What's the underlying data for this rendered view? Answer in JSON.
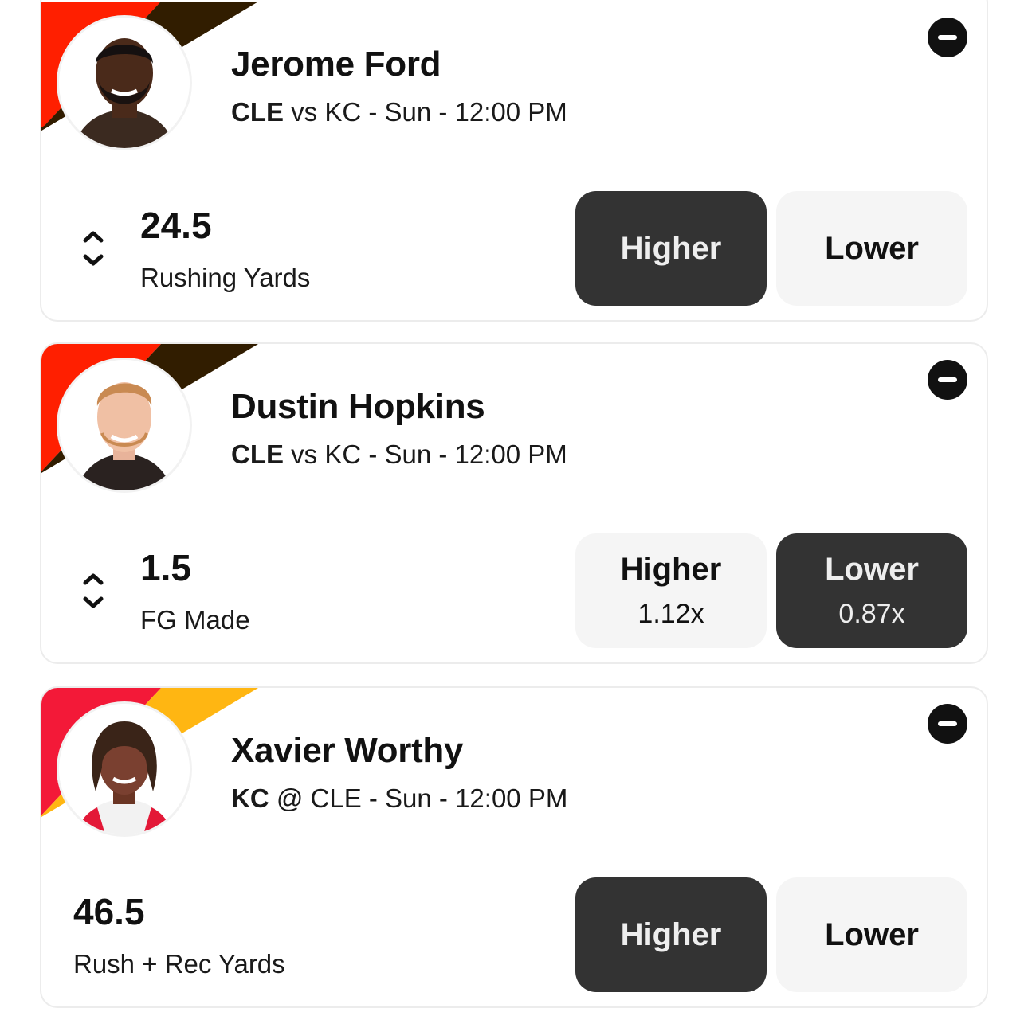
{
  "cards": [
    {
      "player": "Jerome Ford",
      "team": "CLE",
      "matchup": " vs KC - Sun - 12:00 PM",
      "line": "24.5",
      "stat": "Rushing Yards",
      "higher": {
        "label": "Higher",
        "multiplier": ""
      },
      "lower": {
        "label": "Lower",
        "multiplier": ""
      },
      "selected": "higher",
      "team_colors": {
        "primary": "#ff1f00",
        "secondary": "#311d00"
      },
      "icons": {
        "remove": "minus-circle-icon",
        "adjust": "chevron-up-down-icon"
      }
    },
    {
      "player": "Dustin Hopkins",
      "team": "CLE",
      "matchup": " vs KC - Sun - 12:00 PM",
      "line": "1.5",
      "stat": "FG Made",
      "higher": {
        "label": "Higher",
        "multiplier": "1.12x"
      },
      "lower": {
        "label": "Lower",
        "multiplier": "0.87x"
      },
      "selected": "lower",
      "team_colors": {
        "primary": "#ff1f00",
        "secondary": "#311d00"
      },
      "icons": {
        "remove": "minus-circle-icon",
        "adjust": "chevron-up-down-icon"
      }
    },
    {
      "player": "Xavier Worthy",
      "team": "KC",
      "matchup": " @ CLE - Sun - 12:00 PM",
      "line": "46.5",
      "stat": "Rush + Rec Yards",
      "higher": {
        "label": "Higher",
        "multiplier": ""
      },
      "lower": {
        "label": "Lower",
        "multiplier": ""
      },
      "selected": "higher",
      "team_colors": {
        "primary": "#f31938",
        "secondary": "#ffb612"
      },
      "icons": {
        "remove": "minus-circle-icon"
      }
    }
  ],
  "colors": {
    "selected_button": "#333333",
    "unselected_button": "#f5f5f5"
  }
}
